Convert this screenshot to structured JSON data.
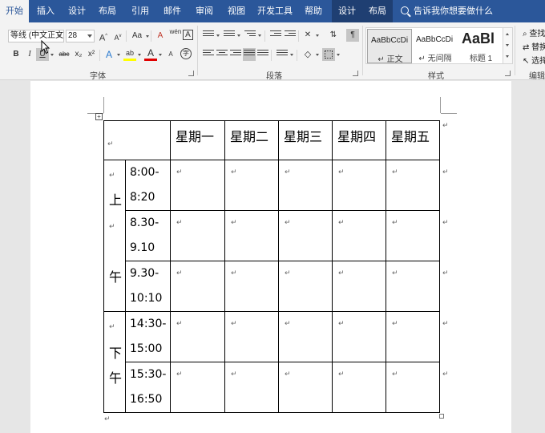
{
  "tabs": [
    {
      "label": "开始",
      "active": true
    },
    {
      "label": "插入"
    },
    {
      "label": "设计"
    },
    {
      "label": "布局"
    },
    {
      "label": "引用"
    },
    {
      "label": "邮件"
    },
    {
      "label": "审阅"
    },
    {
      "label": "视图"
    },
    {
      "label": "开发工具"
    },
    {
      "label": "帮助"
    },
    {
      "label": "设计",
      "contextual": true
    },
    {
      "label": "布局",
      "contextual": true
    }
  ],
  "tell_me": "告诉我你想要做什么",
  "ribbon": {
    "font": {
      "name": "等线 (中文正文)",
      "size": "28",
      "group_label": "字体",
      "grow_label": "A",
      "shrink_label": "A",
      "case_label": "Aa",
      "clear_label": "A",
      "phonetic_label": "wén",
      "border_char_label": "A",
      "bold": "B",
      "italic": "I",
      "underline": "U",
      "strike": "abc",
      "subscript": "x₂",
      "superscript": "x²",
      "effects": "A",
      "highlight": "ab",
      "color": "A",
      "circle": "字"
    },
    "paragraph": {
      "group_label": "段落"
    },
    "styles": {
      "group_label": "样式",
      "items": [
        {
          "sample": "AaBbCcDi",
          "name": "↵ 正文"
        },
        {
          "sample": "AaBbCcDi",
          "name": "↵ 无间隔"
        },
        {
          "sample": "AaBl",
          "name": "标题 1"
        }
      ]
    },
    "editing": {
      "group_label": "编辑",
      "find": "查找",
      "replace": "替换",
      "select": "选择"
    }
  },
  "table": {
    "headers": [
      "星期一",
      "星期二",
      "星期三",
      "星期四",
      "星期五"
    ],
    "am_label_top": "上",
    "am_label_bottom": "午",
    "pm_label_top": "下",
    "pm_label_bottom": "午",
    "times": [
      [
        "8:00-",
        "8:20"
      ],
      [
        "8.30-",
        "9.10"
      ],
      [
        "9.30-",
        "10:10"
      ],
      [
        "14:30-",
        "15:00"
      ],
      [
        "15:30-",
        "16:50"
      ]
    ],
    "para_mark": "↵"
  }
}
